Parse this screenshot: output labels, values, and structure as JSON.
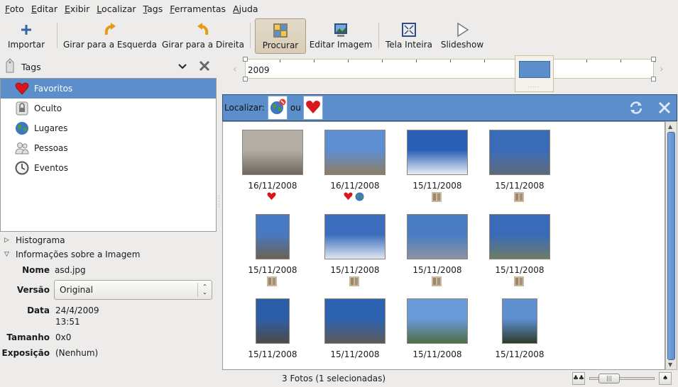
{
  "menubar": [
    {
      "mn": "F",
      "rest": "oto"
    },
    {
      "mn": "E",
      "rest": "ditar"
    },
    {
      "mn": "E",
      "rest": "xibir"
    },
    {
      "mn": "L",
      "rest": "ocalizar"
    },
    {
      "mn": "T",
      "rest": "ags"
    },
    {
      "mn": "F",
      "rest": "erramentas"
    },
    {
      "mn": "A",
      "rest": "juda"
    }
  ],
  "toolbar": {
    "import": "Importar",
    "rotate_left": "Girar para a Esquerda",
    "rotate_right": "Girar para a Direita",
    "find": "Procurar",
    "edit": "Editar Imagem",
    "fullscreen": "Tela Inteira",
    "slideshow": "Slideshow"
  },
  "tags": {
    "header": "Tags",
    "items": [
      {
        "label": "Favoritos",
        "icon": "heart-icon",
        "selected": true
      },
      {
        "label": "Oculto",
        "icon": "lock-icon"
      },
      {
        "label": "Lugares",
        "icon": "globe-icon"
      },
      {
        "label": "Pessoas",
        "icon": "people-icon"
      },
      {
        "label": "Eventos",
        "icon": "clock-icon"
      }
    ]
  },
  "sections": {
    "histogram": "Histograma",
    "info": "Informações sobre a Imagem"
  },
  "info": {
    "name_label": "Nome",
    "name_value": "asd.jpg",
    "version_label": "Versão",
    "version_value": "Original",
    "date_label": "Data",
    "date_value": "24/4/2009",
    "time_value": "13:51",
    "size_label": "Tamanho",
    "size_value": "0x0",
    "exposure_label": "Exposição",
    "exposure_value": "(Nenhum)"
  },
  "timeline": {
    "year": "2009"
  },
  "findbar": {
    "label": "Localizar:",
    "or": "ou"
  },
  "photos": [
    {
      "date": "16/11/2008",
      "tags": [
        "heart"
      ],
      "colors": [
        "#b3aea5",
        "#6d675e"
      ]
    },
    {
      "date": "16/11/2008",
      "tags": [
        "heart",
        "globe"
      ],
      "colors": [
        "#5d8ed0",
        "#8d7d64"
      ]
    },
    {
      "date": "15/11/2008",
      "tags": [
        "tag"
      ],
      "colors": [
        "#2a5fb6",
        "#e9eef6"
      ]
    },
    {
      "date": "15/11/2008",
      "tags": [
        "tag"
      ],
      "colors": [
        "#3b6cb7",
        "#5d6a7a"
      ]
    },
    {
      "date": "15/11/2008",
      "tags": [
        "tag"
      ],
      "colors": [
        "#4679c2",
        "#6c6253"
      ]
    },
    {
      "date": "15/11/2008",
      "tags": [
        "tag"
      ],
      "colors": [
        "#3c6dbc",
        "#dde6f0"
      ]
    },
    {
      "date": "15/11/2008",
      "tags": [
        "tag"
      ],
      "colors": [
        "#4a7cc4",
        "#8b93a0"
      ]
    },
    {
      "date": "15/11/2008",
      "tags": [
        "tag"
      ],
      "colors": [
        "#3a6bb8",
        "#6b7c66"
      ]
    },
    {
      "date": "15/11/2008",
      "tags": [],
      "colors": [
        "#2c5ea8",
        "#4d4a45"
      ]
    },
    {
      "date": "15/11/2008",
      "tags": [],
      "colors": [
        "#2d62b0",
        "#5b5a56"
      ]
    },
    {
      "date": "15/11/2008",
      "tags": [],
      "colors": [
        "#6a9bd8",
        "#4e6e48"
      ]
    },
    {
      "date": "15/11/2008",
      "tags": [],
      "colors": [
        "#5f8fcf",
        "#2e3b2c"
      ]
    }
  ],
  "status": "3 Fotos (1 selecionadas)",
  "colors": {
    "selection": "#5b8ecb",
    "heart": "#d8161b"
  }
}
